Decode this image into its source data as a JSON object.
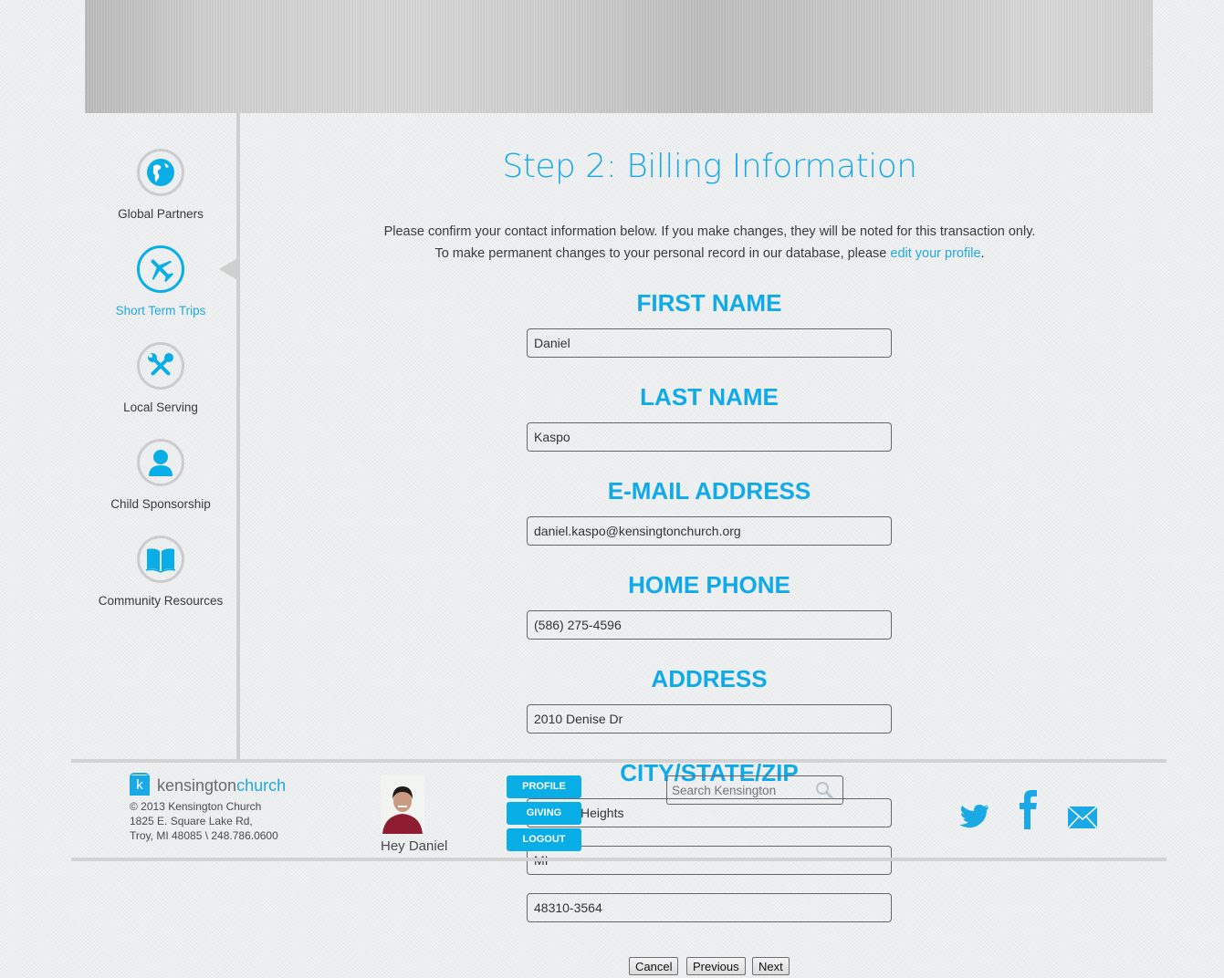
{
  "sidebar": {
    "items": [
      {
        "label": "Global Partners",
        "icon": "globe-icon",
        "active": false
      },
      {
        "label": "Short Term Trips",
        "icon": "airplane-icon",
        "active": true
      },
      {
        "label": "Local Serving",
        "icon": "tools-icon",
        "active": false
      },
      {
        "label": "Child Sponsorship",
        "icon": "person-icon",
        "active": false
      },
      {
        "label": "Community Resources",
        "icon": "book-icon",
        "active": false
      }
    ]
  },
  "main": {
    "title": "Step 2: Billing Information",
    "intro_line1": "Please confirm your contact information below. If you make changes, they will be noted for this transaction only.",
    "intro_line2_prefix": "To make permanent changes to your personal record in our database, please ",
    "intro_link": "edit your profile",
    "intro_line2_suffix": ".",
    "fields": {
      "first_name": {
        "label": "FIRST NAME",
        "value": "Daniel"
      },
      "last_name": {
        "label": "LAST NAME",
        "value": "Kaspo"
      },
      "email": {
        "label": "E-MAIL ADDRESS",
        "value": "daniel.kaspo@kensingtonchurch.org"
      },
      "home_phone": {
        "label": "HOME PHONE",
        "value": "(586) 275-4596"
      },
      "address": {
        "label": "ADDRESS",
        "value": "2010 Denise Dr"
      },
      "city_state_zip": {
        "label": "CITY/STATE/ZIP",
        "city": "Heights",
        "state": "MI",
        "zip": "48310-3564"
      }
    },
    "buttons": {
      "cancel": "Cancel",
      "previous": "Previous",
      "next": "Next"
    }
  },
  "footer": {
    "logo_mark": "k",
    "logo_text_a": "kensington",
    "logo_text_b": "church",
    "copyright": "© 2013 Kensington Church",
    "address1": "1825 E. Square Lake Rd,",
    "address2": "Troy, MI 48085 \\ 248.786.0600",
    "greeting": "Hey Daniel",
    "menu": {
      "profile": "PROFILE",
      "giving": "GIVING",
      "logout": "LOGOUT"
    },
    "search_placeholder": "Search Kensington",
    "social": [
      "twitter-icon",
      "facebook-icon",
      "email-icon"
    ]
  },
  "colors": {
    "accent": "#0aaee6",
    "link": "#21a8e1"
  }
}
